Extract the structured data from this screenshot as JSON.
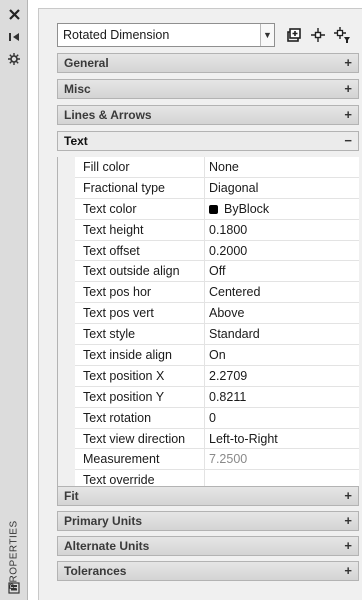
{
  "left_strip": {
    "title": "PROPERTIES",
    "icons": [
      "close-icon",
      "auto-hide-icon",
      "settings-icon",
      "properties-panel-icon"
    ]
  },
  "toolbar": {
    "object_type": "Rotated Dimension",
    "icons": [
      "toggle-pickadd-icon",
      "select-objects-icon",
      "quick-select-icon"
    ]
  },
  "sections": [
    {
      "label": "General",
      "toggle": "+"
    },
    {
      "label": "Misc",
      "toggle": "+"
    },
    {
      "label": "Lines & Arrows",
      "toggle": "+"
    },
    {
      "label": "Text",
      "toggle": "−"
    },
    {
      "label": "Fit",
      "toggle": "+"
    },
    {
      "label": "Primary Units",
      "toggle": "+"
    },
    {
      "label": "Alternate Units",
      "toggle": "+"
    },
    {
      "label": "Tolerances",
      "toggle": "+"
    }
  ],
  "text_properties": [
    {
      "name": "Fill color",
      "value": "None"
    },
    {
      "name": "Fractional type",
      "value": "Diagonal"
    },
    {
      "name": "Text color",
      "value": "ByBlock",
      "swatch": "#000000"
    },
    {
      "name": "Text height",
      "value": "0.1800"
    },
    {
      "name": "Text offset",
      "value": "0.2000"
    },
    {
      "name": "Text outside align",
      "value": "Off"
    },
    {
      "name": "Text pos hor",
      "value": "Centered"
    },
    {
      "name": "Text pos vert",
      "value": "Above"
    },
    {
      "name": "Text style",
      "value": "Standard"
    },
    {
      "name": "Text inside align",
      "value": "On"
    },
    {
      "name": "Text position X",
      "value": "2.2709"
    },
    {
      "name": "Text position Y",
      "value": "0.8211"
    },
    {
      "name": "Text rotation",
      "value": "0"
    },
    {
      "name": "Text view direction",
      "value": "Left-to-Right"
    },
    {
      "name": "Measurement",
      "value": "7.2500"
    },
    {
      "name": "Text override",
      "value": ""
    }
  ]
}
